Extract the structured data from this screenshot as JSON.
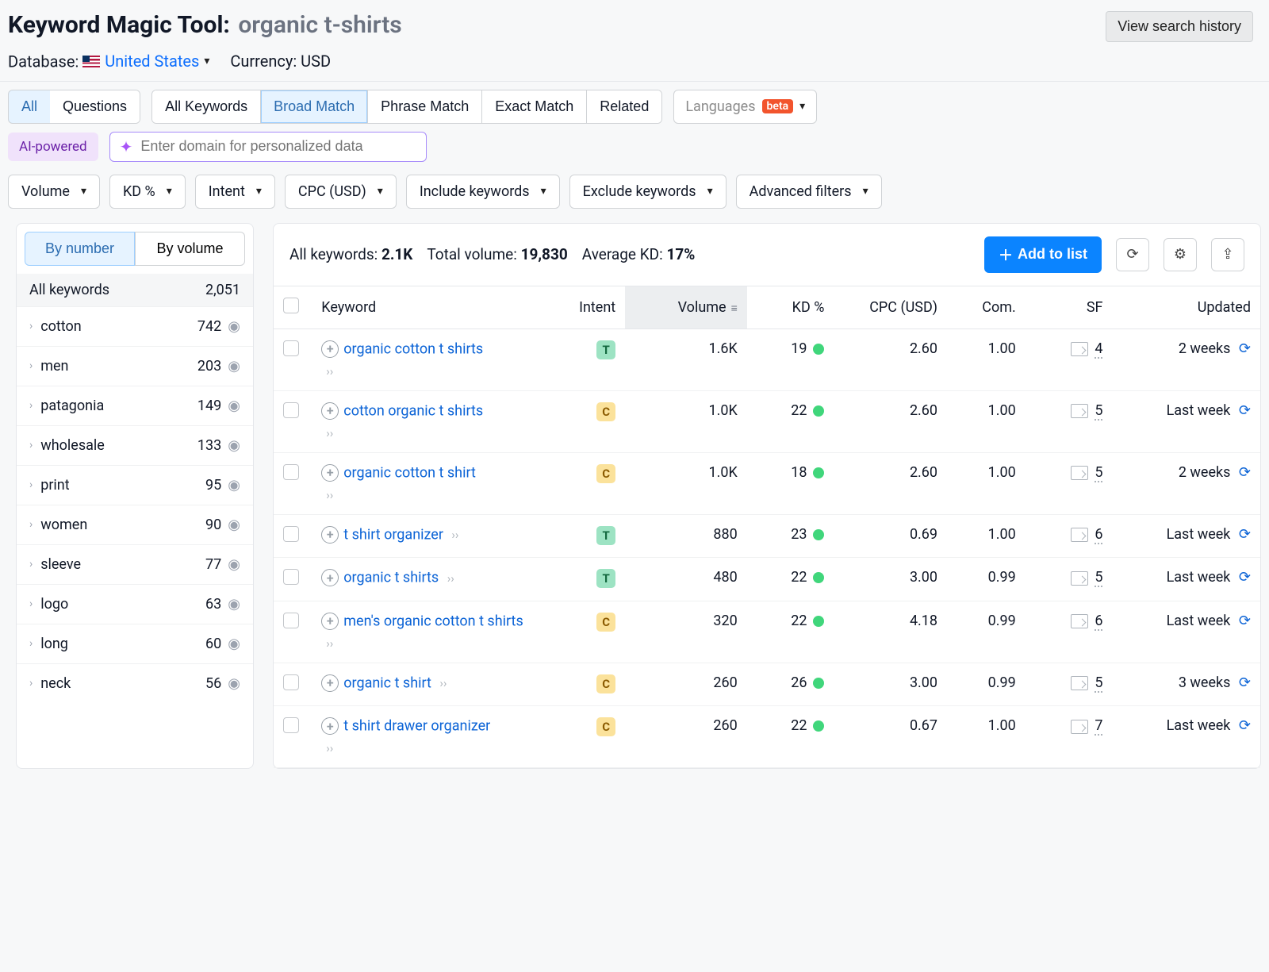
{
  "header": {
    "title": "Keyword Magic Tool:",
    "query": "organic t-shirts",
    "database_label": "Database:",
    "country": "United States",
    "currency_label": "Currency: USD",
    "history_btn": "View search history"
  },
  "tabs1": {
    "items": [
      "All",
      "Questions"
    ],
    "active": 0
  },
  "tabs2": {
    "items": [
      "All Keywords",
      "Broad Match",
      "Phrase Match",
      "Exact Match",
      "Related"
    ],
    "active": 1
  },
  "languages_label": "Languages",
  "beta_label": "beta",
  "ai_pill": "AI-powered",
  "ai_placeholder": "Enter domain for personalized data",
  "filters": [
    "Volume",
    "KD %",
    "Intent",
    "CPC (USD)",
    "Include keywords",
    "Exclude keywords",
    "Advanced filters"
  ],
  "sidebar": {
    "tabs": [
      "By number",
      "By volume"
    ],
    "active": 0,
    "all_label": "All keywords",
    "all_count": "2,051",
    "groups": [
      {
        "name": "cotton",
        "count": "742"
      },
      {
        "name": "men",
        "count": "203"
      },
      {
        "name": "patagonia",
        "count": "149"
      },
      {
        "name": "wholesale",
        "count": "133"
      },
      {
        "name": "print",
        "count": "95"
      },
      {
        "name": "women",
        "count": "90"
      },
      {
        "name": "sleeve",
        "count": "77"
      },
      {
        "name": "logo",
        "count": "63"
      },
      {
        "name": "long",
        "count": "60"
      },
      {
        "name": "neck",
        "count": "56"
      }
    ]
  },
  "summary": {
    "all_label": "All keywords:",
    "all_value": "2.1K",
    "vol_label": "Total volume:",
    "vol_value": "19,830",
    "kd_label": "Average KD:",
    "kd_value": "17%",
    "add_btn": "Add to list"
  },
  "columns": [
    "Keyword",
    "Intent",
    "Volume",
    "KD %",
    "CPC (USD)",
    "Com.",
    "SF",
    "Updated"
  ],
  "rows": [
    {
      "keyword": "organic cotton t shirts",
      "expand": true,
      "intent": "T",
      "volume": "1.6K",
      "kd": "19",
      "cpc": "2.60",
      "com": "1.00",
      "sf": "4",
      "updated": "2 weeks"
    },
    {
      "keyword": "cotton organic t shirts",
      "expand": true,
      "intent": "C",
      "volume": "1.0K",
      "kd": "22",
      "cpc": "2.60",
      "com": "1.00",
      "sf": "5",
      "updated": "Last week"
    },
    {
      "keyword": "organic cotton t shirt",
      "expand": true,
      "intent": "C",
      "volume": "1.0K",
      "kd": "18",
      "cpc": "2.60",
      "com": "1.00",
      "sf": "5",
      "updated": "2 weeks"
    },
    {
      "keyword": "t shirt organizer",
      "expand": false,
      "intent": "T",
      "volume": "880",
      "kd": "23",
      "cpc": "0.69",
      "com": "1.00",
      "sf": "6",
      "updated": "Last week"
    },
    {
      "keyword": "organic t shirts",
      "expand": false,
      "intent": "T",
      "volume": "480",
      "kd": "22",
      "cpc": "3.00",
      "com": "0.99",
      "sf": "5",
      "updated": "Last week"
    },
    {
      "keyword": "men's organic cotton t shirts",
      "expand": true,
      "intent": "C",
      "volume": "320",
      "kd": "22",
      "cpc": "4.18",
      "com": "0.99",
      "sf": "6",
      "updated": "Last week"
    },
    {
      "keyword": "organic t shirt",
      "expand": false,
      "intent": "C",
      "volume": "260",
      "kd": "26",
      "cpc": "3.00",
      "com": "0.99",
      "sf": "5",
      "updated": "3 weeks"
    },
    {
      "keyword": "t shirt drawer organizer",
      "expand": true,
      "intent": "C",
      "volume": "260",
      "kd": "22",
      "cpc": "0.67",
      "com": "1.00",
      "sf": "7",
      "updated": "Last week"
    }
  ]
}
